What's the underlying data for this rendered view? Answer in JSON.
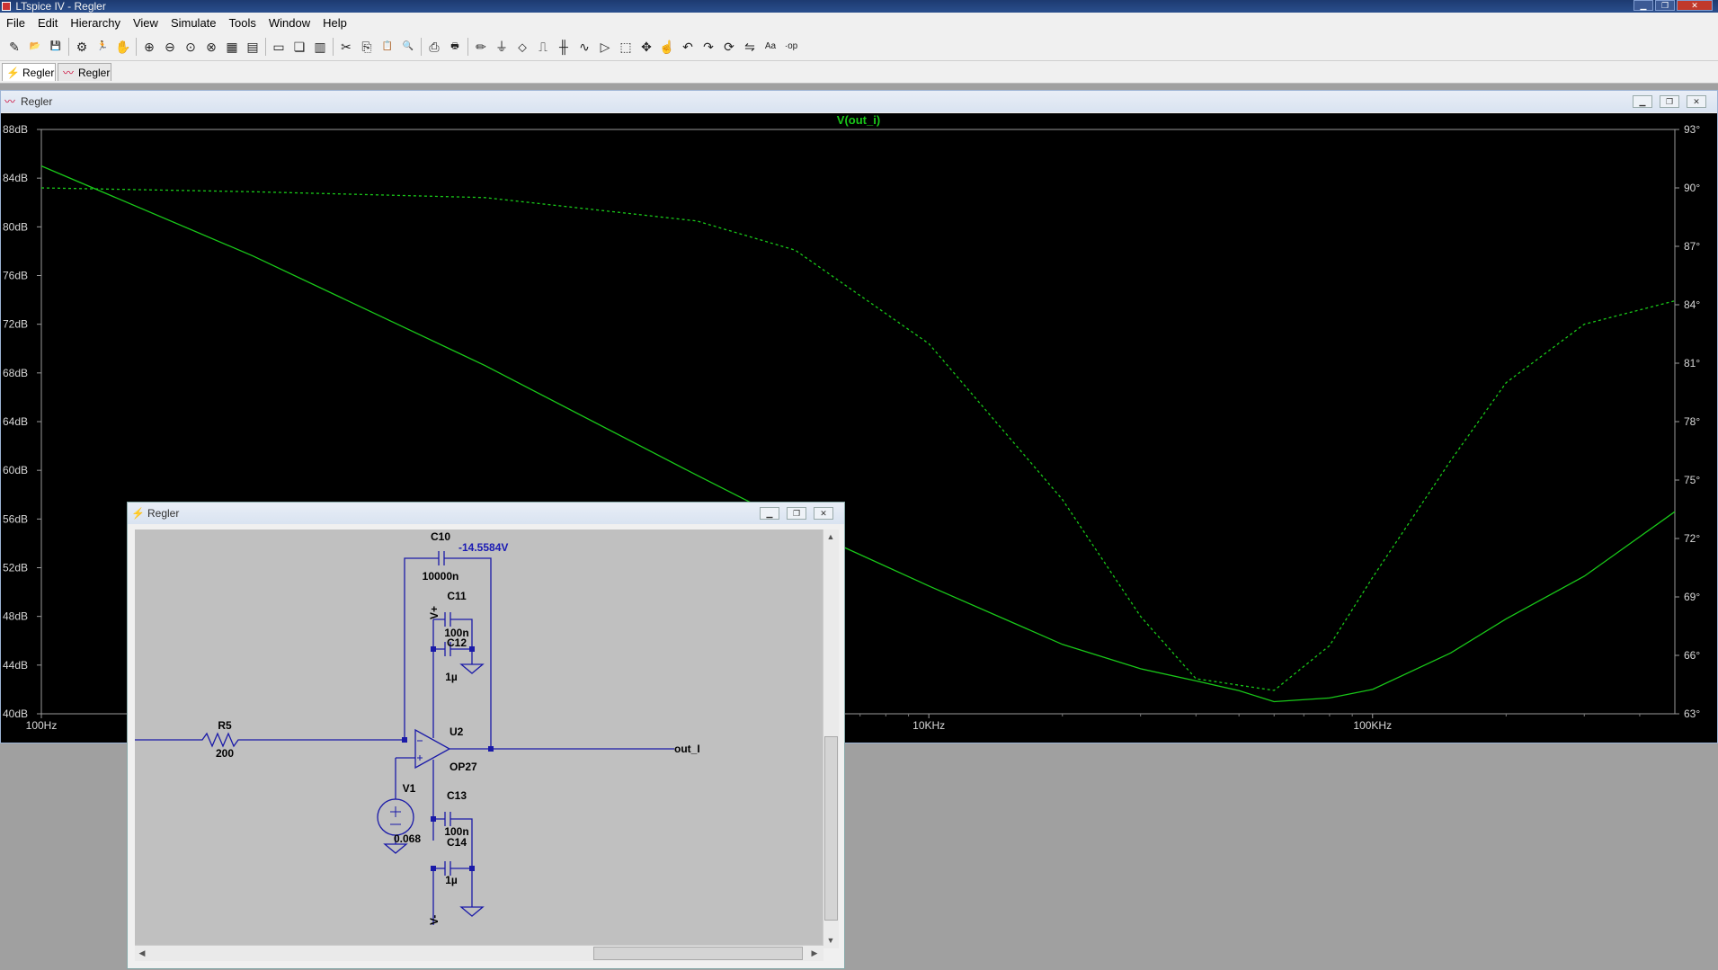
{
  "window": {
    "title": "LTspice IV - Regler"
  },
  "menu": [
    "File",
    "Edit",
    "Hierarchy",
    "View",
    "Simulate",
    "Tools",
    "Window",
    "Help"
  ],
  "toolbar": {
    "icons": [
      "new-schematic-icon",
      "open-icon",
      "save-icon",
      "control-panel-icon",
      "run-icon",
      "halt-icon",
      "zoom-in-icon",
      "zoom-out-icon",
      "zoom-full-icon",
      "zoom-cancel-icon",
      "autorange-icon",
      "grid-icon",
      "tile-horizontal-icon",
      "cascade-icon",
      "tile-vertical-icon",
      "cut-icon",
      "copy-icon",
      "paste-icon",
      "find-icon",
      "print-preview-icon",
      "print-icon",
      "draw-wire-icon",
      "ground-icon",
      "label-net-icon",
      "resistor-icon",
      "capacitor-icon",
      "inductor-icon",
      "diode-icon",
      "component-icon",
      "move-icon",
      "drag-icon",
      "undo-icon",
      "redo-icon",
      "rotate-icon",
      "mirror-icon",
      "text-icon",
      "spice-directive-icon"
    ]
  },
  "tabs": [
    {
      "label": "Regler",
      "icon": "schematic-icon",
      "active": true
    },
    {
      "label": "Regler",
      "icon": "waveform-icon",
      "active": false
    }
  ],
  "plot_window": {
    "title": "Regler",
    "trace_label": "V(out_i)"
  },
  "schematic_window": {
    "title": "Regler"
  },
  "colors": {
    "trace": "#19c819",
    "plot_bg": "#000000",
    "wire": "#1a1aa8",
    "schematic_bg": "#c0c0c0",
    "net_voltage": "#1a1ab4"
  },
  "chart_data": {
    "type": "line",
    "title": "V(out_i)",
    "x_scale": "log",
    "xlim": [
      100,
      480000
    ],
    "x_ticks": [
      {
        "value": 100,
        "label": "100Hz"
      },
      {
        "value": 10000,
        "label": "10KHz"
      },
      {
        "value": 100000,
        "label": "100KHz"
      }
    ],
    "left_axis": {
      "unit": "dB",
      "ylim": [
        40,
        88
      ],
      "ticks": [
        "88dB",
        "84dB",
        "80dB",
        "76dB",
        "72dB",
        "68dB",
        "64dB",
        "60dB",
        "56dB",
        "52dB",
        "48dB",
        "44dB",
        "40dB"
      ]
    },
    "right_axis": {
      "unit": "°",
      "ylim": [
        63,
        93
      ],
      "ticks": [
        "93°",
        "90°",
        "87°",
        "84°",
        "81°",
        "78°",
        "75°",
        "72°",
        "69°",
        "66°",
        "63°"
      ]
    },
    "series": [
      {
        "style": "solid",
        "axis": "left",
        "points": [
          [
            100,
            85
          ],
          [
            300,
            77.6
          ],
          [
            1000,
            68.6
          ],
          [
            3000,
            59.6
          ],
          [
            5000,
            55.5
          ],
          [
            10000,
            50.5
          ],
          [
            20000,
            45.7
          ],
          [
            30000,
            43.7
          ],
          [
            40000,
            42.7
          ],
          [
            50000,
            41.9
          ],
          [
            60000,
            41.0
          ],
          [
            80000,
            41.3
          ],
          [
            100000,
            42.0
          ],
          [
            150000,
            45.0
          ],
          [
            200000,
            47.8
          ],
          [
            300000,
            51.3
          ],
          [
            480000,
            56.6
          ]
        ]
      },
      {
        "style": "dashed",
        "axis": "right",
        "points": [
          [
            100,
            90
          ],
          [
            300,
            89.8
          ],
          [
            1000,
            89.5
          ],
          [
            3000,
            88.3
          ],
          [
            5000,
            86.8
          ],
          [
            10000,
            82
          ],
          [
            20000,
            74
          ],
          [
            30000,
            68
          ],
          [
            40000,
            64.8
          ],
          [
            60000,
            64.2
          ],
          [
            80000,
            66.5
          ],
          [
            100000,
            70
          ],
          [
            150000,
            76
          ],
          [
            200000,
            80
          ],
          [
            300000,
            83
          ],
          [
            480000,
            84.2
          ]
        ]
      }
    ]
  },
  "schematic": {
    "components": [
      {
        "ref": "C10",
        "value": "10000n"
      },
      {
        "ref": "C11",
        "value": "100n"
      },
      {
        "ref": "C12",
        "value": "1µ"
      },
      {
        "ref": "R5",
        "value": "200"
      },
      {
        "ref": "U2",
        "value": "OP27"
      },
      {
        "ref": "V1",
        "value": "0.068"
      },
      {
        "ref": "C13",
        "value": "100n"
      },
      {
        "ref": "C14",
        "value": "1µ"
      }
    ],
    "net_voltage": "-14.5584V",
    "labels": {
      "vplus": "V+",
      "vminus": "V-",
      "out": "out_I"
    }
  }
}
